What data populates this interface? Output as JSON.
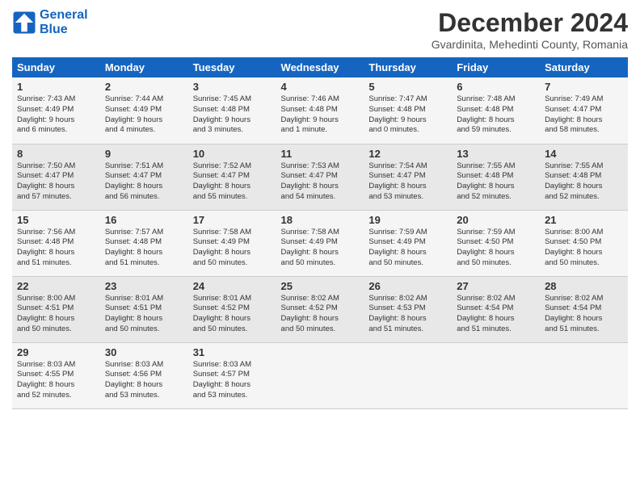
{
  "header": {
    "logo_line1": "General",
    "logo_line2": "Blue",
    "month": "December 2024",
    "location": "Gvardinita, Mehedinti County, Romania"
  },
  "days_of_week": [
    "Sunday",
    "Monday",
    "Tuesday",
    "Wednesday",
    "Thursday",
    "Friday",
    "Saturday"
  ],
  "weeks": [
    [
      {
        "day": "1",
        "info": "Sunrise: 7:43 AM\nSunset: 4:49 PM\nDaylight: 9 hours\nand 6 minutes."
      },
      {
        "day": "2",
        "info": "Sunrise: 7:44 AM\nSunset: 4:49 PM\nDaylight: 9 hours\nand 4 minutes."
      },
      {
        "day": "3",
        "info": "Sunrise: 7:45 AM\nSunset: 4:48 PM\nDaylight: 9 hours\nand 3 minutes."
      },
      {
        "day": "4",
        "info": "Sunrise: 7:46 AM\nSunset: 4:48 PM\nDaylight: 9 hours\nand 1 minute."
      },
      {
        "day": "5",
        "info": "Sunrise: 7:47 AM\nSunset: 4:48 PM\nDaylight: 9 hours\nand 0 minutes."
      },
      {
        "day": "6",
        "info": "Sunrise: 7:48 AM\nSunset: 4:48 PM\nDaylight: 8 hours\nand 59 minutes."
      },
      {
        "day": "7",
        "info": "Sunrise: 7:49 AM\nSunset: 4:47 PM\nDaylight: 8 hours\nand 58 minutes."
      }
    ],
    [
      {
        "day": "8",
        "info": "Sunrise: 7:50 AM\nSunset: 4:47 PM\nDaylight: 8 hours\nand 57 minutes."
      },
      {
        "day": "9",
        "info": "Sunrise: 7:51 AM\nSunset: 4:47 PM\nDaylight: 8 hours\nand 56 minutes."
      },
      {
        "day": "10",
        "info": "Sunrise: 7:52 AM\nSunset: 4:47 PM\nDaylight: 8 hours\nand 55 minutes."
      },
      {
        "day": "11",
        "info": "Sunrise: 7:53 AM\nSunset: 4:47 PM\nDaylight: 8 hours\nand 54 minutes."
      },
      {
        "day": "12",
        "info": "Sunrise: 7:54 AM\nSunset: 4:47 PM\nDaylight: 8 hours\nand 53 minutes."
      },
      {
        "day": "13",
        "info": "Sunrise: 7:55 AM\nSunset: 4:48 PM\nDaylight: 8 hours\nand 52 minutes."
      },
      {
        "day": "14",
        "info": "Sunrise: 7:55 AM\nSunset: 4:48 PM\nDaylight: 8 hours\nand 52 minutes."
      }
    ],
    [
      {
        "day": "15",
        "info": "Sunrise: 7:56 AM\nSunset: 4:48 PM\nDaylight: 8 hours\nand 51 minutes."
      },
      {
        "day": "16",
        "info": "Sunrise: 7:57 AM\nSunset: 4:48 PM\nDaylight: 8 hours\nand 51 minutes."
      },
      {
        "day": "17",
        "info": "Sunrise: 7:58 AM\nSunset: 4:49 PM\nDaylight: 8 hours\nand 50 minutes."
      },
      {
        "day": "18",
        "info": "Sunrise: 7:58 AM\nSunset: 4:49 PM\nDaylight: 8 hours\nand 50 minutes."
      },
      {
        "day": "19",
        "info": "Sunrise: 7:59 AM\nSunset: 4:49 PM\nDaylight: 8 hours\nand 50 minutes."
      },
      {
        "day": "20",
        "info": "Sunrise: 7:59 AM\nSunset: 4:50 PM\nDaylight: 8 hours\nand 50 minutes."
      },
      {
        "day": "21",
        "info": "Sunrise: 8:00 AM\nSunset: 4:50 PM\nDaylight: 8 hours\nand 50 minutes."
      }
    ],
    [
      {
        "day": "22",
        "info": "Sunrise: 8:00 AM\nSunset: 4:51 PM\nDaylight: 8 hours\nand 50 minutes."
      },
      {
        "day": "23",
        "info": "Sunrise: 8:01 AM\nSunset: 4:51 PM\nDaylight: 8 hours\nand 50 minutes."
      },
      {
        "day": "24",
        "info": "Sunrise: 8:01 AM\nSunset: 4:52 PM\nDaylight: 8 hours\nand 50 minutes."
      },
      {
        "day": "25",
        "info": "Sunrise: 8:02 AM\nSunset: 4:52 PM\nDaylight: 8 hours\nand 50 minutes."
      },
      {
        "day": "26",
        "info": "Sunrise: 8:02 AM\nSunset: 4:53 PM\nDaylight: 8 hours\nand 51 minutes."
      },
      {
        "day": "27",
        "info": "Sunrise: 8:02 AM\nSunset: 4:54 PM\nDaylight: 8 hours\nand 51 minutes."
      },
      {
        "day": "28",
        "info": "Sunrise: 8:02 AM\nSunset: 4:54 PM\nDaylight: 8 hours\nand 51 minutes."
      }
    ],
    [
      {
        "day": "29",
        "info": "Sunrise: 8:03 AM\nSunset: 4:55 PM\nDaylight: 8 hours\nand 52 minutes."
      },
      {
        "day": "30",
        "info": "Sunrise: 8:03 AM\nSunset: 4:56 PM\nDaylight: 8 hours\nand 53 minutes."
      },
      {
        "day": "31",
        "info": "Sunrise: 8:03 AM\nSunset: 4:57 PM\nDaylight: 8 hours\nand 53 minutes."
      },
      {
        "day": "",
        "info": ""
      },
      {
        "day": "",
        "info": ""
      },
      {
        "day": "",
        "info": ""
      },
      {
        "day": "",
        "info": ""
      }
    ]
  ]
}
